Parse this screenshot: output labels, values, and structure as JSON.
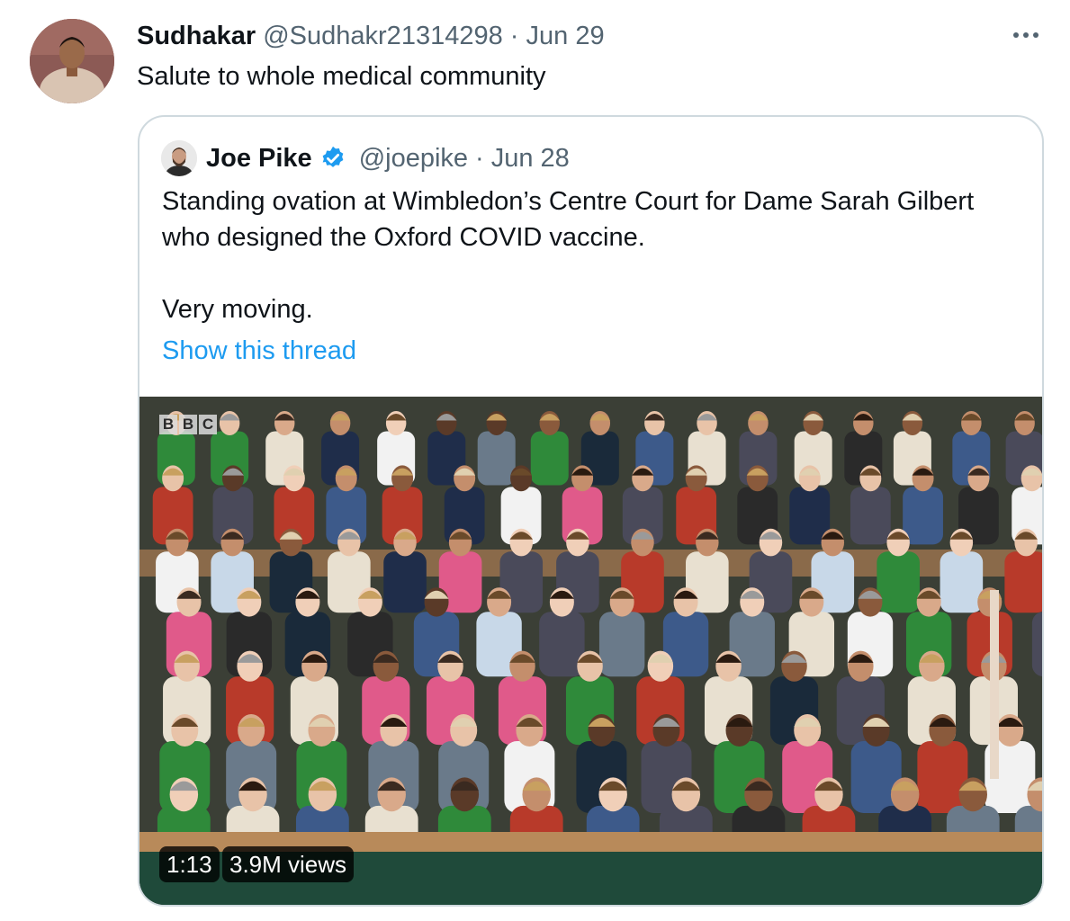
{
  "tweet": {
    "display_name": "Sudhakar",
    "handle": "@Sudhakr21314298",
    "separator": "·",
    "date": "Jun 29",
    "text": "Salute to whole medical community",
    "more_icon": "more-horizontal-icon"
  },
  "quote": {
    "display_name": "Joe Pike",
    "verified": true,
    "verified_color": "#1d9bf0",
    "handle": "@joepike",
    "separator": "·",
    "date": "Jun 28",
    "text_line1": "Standing ovation at Wimbledon’s Centre Court for Dame Sarah Gilbert who designed the Oxford COVID vaccine.",
    "text_line2": "Very moving.",
    "show_thread": "Show this thread"
  },
  "video": {
    "logo_letters": [
      "B",
      "B",
      "C"
    ],
    "duration": "1:13",
    "views": "3.9M views"
  },
  "colors": {
    "link": "#1d9bf0",
    "secondary_text": "#536471",
    "border": "#cfd9de"
  }
}
